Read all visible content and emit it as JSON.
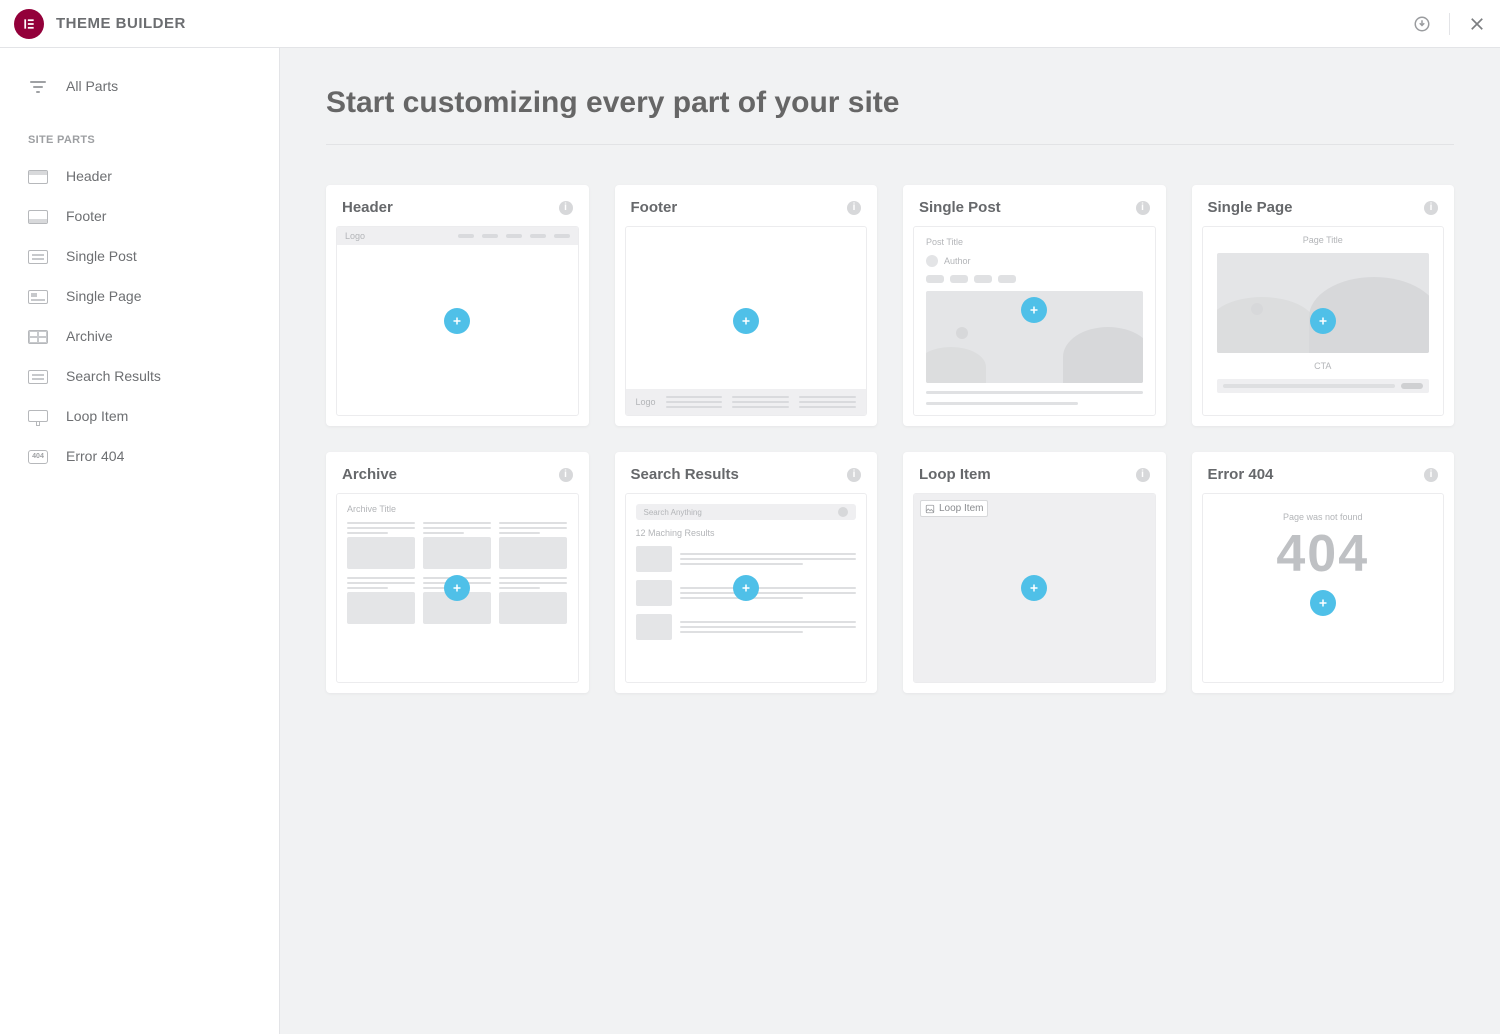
{
  "header": {
    "title": "THEME BUILDER"
  },
  "sidebar": {
    "all_parts": "All Parts",
    "section_label": "SITE PARTS",
    "items": [
      {
        "label": "Header"
      },
      {
        "label": "Footer"
      },
      {
        "label": "Single Post"
      },
      {
        "label": "Single Page"
      },
      {
        "label": "Archive"
      },
      {
        "label": "Search Results"
      },
      {
        "label": "Loop Item"
      },
      {
        "label": "Error 404"
      }
    ]
  },
  "main": {
    "heading": "Start customizing every part of your site",
    "cards": [
      {
        "title": "Header"
      },
      {
        "title": "Footer"
      },
      {
        "title": "Single Post"
      },
      {
        "title": "Single Page"
      },
      {
        "title": "Archive"
      },
      {
        "title": "Search Results"
      },
      {
        "title": "Loop Item"
      },
      {
        "title": "Error 404"
      }
    ],
    "preview": {
      "logo_label": "Logo",
      "post_title": "Post Title",
      "author_label": "Author",
      "page_title": "Page Title",
      "cta_label": "CTA",
      "archive_title": "Archive Title",
      "search_placeholder": "Search Anything",
      "search_results_label": "12 Maching Results",
      "loop_alt": "Loop Item",
      "not_found_label": "Page was not found",
      "not_found_code": "404"
    }
  }
}
